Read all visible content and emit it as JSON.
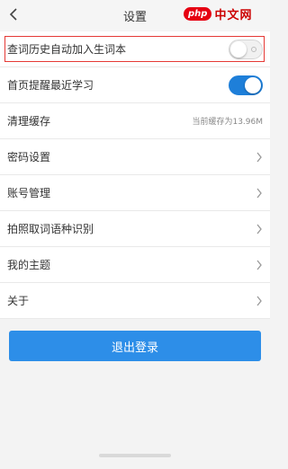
{
  "header": {
    "title": "设置",
    "back_icon": "chevron-left-icon"
  },
  "watermark": {
    "logo": "php",
    "text": "中文网"
  },
  "settings": [
    {
      "label": "查词历史自动加入生词本",
      "control": "toggle",
      "state": "off"
    },
    {
      "label": "首页提醒最近学习",
      "control": "toggle",
      "state": "on"
    },
    {
      "label": "清理缓存",
      "control": "value",
      "value": "当前缓存为13.96M"
    },
    {
      "label": "密码设置",
      "control": "chevron"
    },
    {
      "label": "账号管理",
      "control": "chevron"
    },
    {
      "label": "拍照取词语种识别",
      "control": "chevron"
    },
    {
      "label": "我的主题",
      "control": "chevron"
    },
    {
      "label": "关于",
      "control": "chevron"
    }
  ],
  "logout_label": "退出登录",
  "colors": {
    "accent": "#2d8ee8",
    "toggle_on": "#1e7fd9",
    "highlight_border": "#e53935",
    "background": "#f3f3f3"
  }
}
